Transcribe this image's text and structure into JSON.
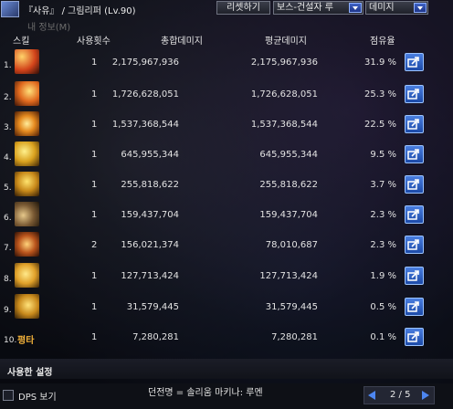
{
  "topbar": {
    "character": "『사유』 / 그림리퍼 (Lv.90)",
    "reset_button": "리셋하기",
    "boss_select": "보스-건설자 루",
    "type_select": "데미지"
  },
  "sub_label": "내 정보(M)",
  "columns": {
    "skill": "스킬",
    "uses": "사용횟수",
    "total": "총합데미지",
    "avg": "평균데미지",
    "share": "점유율"
  },
  "rows": [
    {
      "num": "1.",
      "icon": "skill-icon-1",
      "uses": "1",
      "total": "2,175,967,936",
      "avg": "2,175,967,936",
      "share": "31.9 %"
    },
    {
      "num": "2.",
      "icon": "skill-icon-2",
      "uses": "1",
      "total": "1,726,628,051",
      "avg": "1,726,628,051",
      "share": "25.3 %"
    },
    {
      "num": "3.",
      "icon": "skill-icon-3",
      "uses": "1",
      "total": "1,537,368,544",
      "avg": "1,537,368,544",
      "share": "22.5 %"
    },
    {
      "num": "4.",
      "icon": "skill-icon-4",
      "uses": "1",
      "total": "645,955,344",
      "avg": "645,955,344",
      "share": "9.5 %"
    },
    {
      "num": "5.",
      "icon": "skill-icon-5",
      "uses": "1",
      "total": "255,818,622",
      "avg": "255,818,622",
      "share": "3.7 %"
    },
    {
      "num": "6.",
      "icon": "skill-icon-6",
      "uses": "1",
      "total": "159,437,704",
      "avg": "159,437,704",
      "share": "2.3 %"
    },
    {
      "num": "7.",
      "icon": "skill-icon-7",
      "uses": "2",
      "total": "156,021,374",
      "avg": "78,010,687",
      "share": "2.3 %"
    },
    {
      "num": "8.",
      "icon": "skill-icon-8",
      "uses": "1",
      "total": "127,713,424",
      "avg": "127,713,424",
      "share": "1.9 %"
    },
    {
      "num": "9.",
      "icon": "skill-icon-9",
      "uses": "1",
      "total": "31,579,445",
      "avg": "31,579,445",
      "share": "0.5 %"
    },
    {
      "num": "10.",
      "label": "평타",
      "uses": "1",
      "total": "7,280,281",
      "avg": "7,280,281",
      "share": "0.1 %"
    }
  ],
  "settings_label": "사용한 설정",
  "footer": {
    "dps_label": "DPS 보기",
    "dungeon": "던전명 = 솔리움 마키나: 루멘",
    "page": "2 / 5"
  },
  "colors": {
    "accent_blue": "#2a5fd0",
    "label_gold": "#f2b13a"
  }
}
